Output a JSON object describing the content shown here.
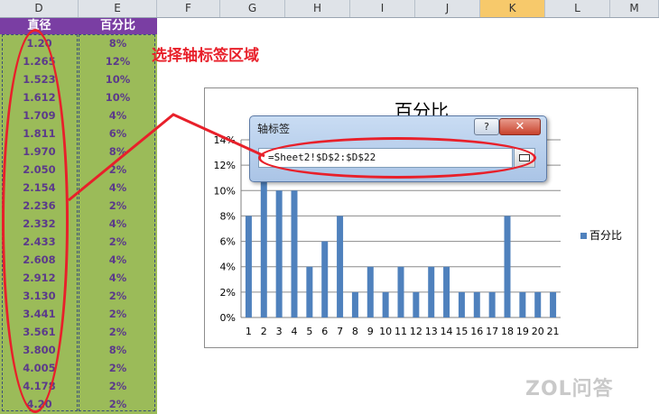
{
  "columns": [
    {
      "id": "D",
      "label": "D"
    },
    {
      "id": "E",
      "label": "E"
    },
    {
      "id": "F",
      "label": "F"
    },
    {
      "id": "G",
      "label": "G"
    },
    {
      "id": "H",
      "label": "H"
    },
    {
      "id": "I",
      "label": "I"
    },
    {
      "id": "J",
      "label": "J"
    },
    {
      "id": "K",
      "label": "K"
    },
    {
      "id": "L",
      "label": "L"
    },
    {
      "id": "M",
      "label": "M"
    }
  ],
  "table": {
    "header": {
      "diameter": "直径",
      "percent": "百分比"
    },
    "rows": [
      [
        "1.20",
        "8%"
      ],
      [
        "1.265",
        "12%"
      ],
      [
        "1.523",
        "10%"
      ],
      [
        "1.612",
        "10%"
      ],
      [
        "1.709",
        "4%"
      ],
      [
        "1.811",
        "6%"
      ],
      [
        "1.970",
        "8%"
      ],
      [
        "2.050",
        "2%"
      ],
      [
        "2.154",
        "4%"
      ],
      [
        "2.236",
        "2%"
      ],
      [
        "2.332",
        "4%"
      ],
      [
        "2.433",
        "2%"
      ],
      [
        "2.608",
        "4%"
      ],
      [
        "2.912",
        "4%"
      ],
      [
        "3.130",
        "2%"
      ],
      [
        "3.441",
        "2%"
      ],
      [
        "3.561",
        "2%"
      ],
      [
        "3.800",
        "8%"
      ],
      [
        "4.005",
        "2%"
      ],
      [
        "4.178",
        "2%"
      ],
      [
        "4.20",
        "2%"
      ]
    ]
  },
  "annotation": "选择轴标签区域",
  "dialog": {
    "title": "轴标签",
    "help": "?",
    "close": "✕",
    "range_value": "=Sheet2!$D$2:$D$22"
  },
  "chart_data": {
    "type": "bar",
    "title": "百分比",
    "categories": [
      "1",
      "2",
      "3",
      "4",
      "5",
      "6",
      "7",
      "8",
      "9",
      "10",
      "11",
      "12",
      "13",
      "14",
      "15",
      "16",
      "17",
      "18",
      "19",
      "20",
      "21"
    ],
    "series": [
      {
        "name": "百分比",
        "values": [
          8,
          12,
          10,
          10,
          4,
          6,
          8,
          2,
          4,
          2,
          4,
          2,
          4,
          4,
          2,
          2,
          2,
          8,
          2,
          2,
          2
        ]
      }
    ],
    "yticks": [
      "0%",
      "2%",
      "4%",
      "6%",
      "8%",
      "10%",
      "12%",
      "14%"
    ],
    "ylim": [
      0,
      14
    ],
    "legend": "right",
    "grid": true,
    "bar_color": "#4f81bd"
  },
  "watermark": "ZOL问答",
  "colors": {
    "highlight": "#e8202a",
    "green": "#9bbb59",
    "purple": "#7a3ea3"
  }
}
